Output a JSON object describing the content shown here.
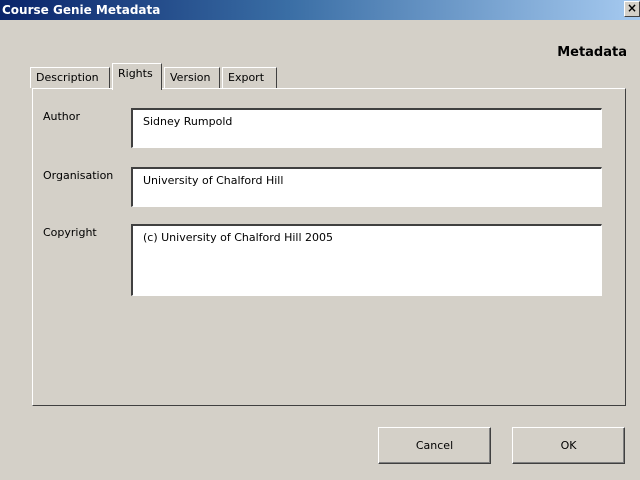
{
  "window": {
    "title": "Course Genie Metadata",
    "close_symbol": "×"
  },
  "heading": "Metadata",
  "tabs": [
    {
      "label": "Description",
      "active": false
    },
    {
      "label": "Rights",
      "active": true
    },
    {
      "label": "Version",
      "active": false
    },
    {
      "label": "Export",
      "active": false
    }
  ],
  "fields": {
    "author": {
      "label": "Author",
      "value": "Sidney Rumpold"
    },
    "organisation": {
      "label": "Organisation",
      "value": "University of Chalford Hill"
    },
    "copyright": {
      "label": "Copyright",
      "value": "(c) University of Chalford Hill 2005"
    }
  },
  "buttons": {
    "cancel": "Cancel",
    "ok": "OK"
  },
  "colors": {
    "face": "#d4d0c8",
    "titlebar_start": "#0a246a",
    "titlebar_end": "#a6caf0"
  },
  "icons": {
    "close": "close-icon"
  }
}
